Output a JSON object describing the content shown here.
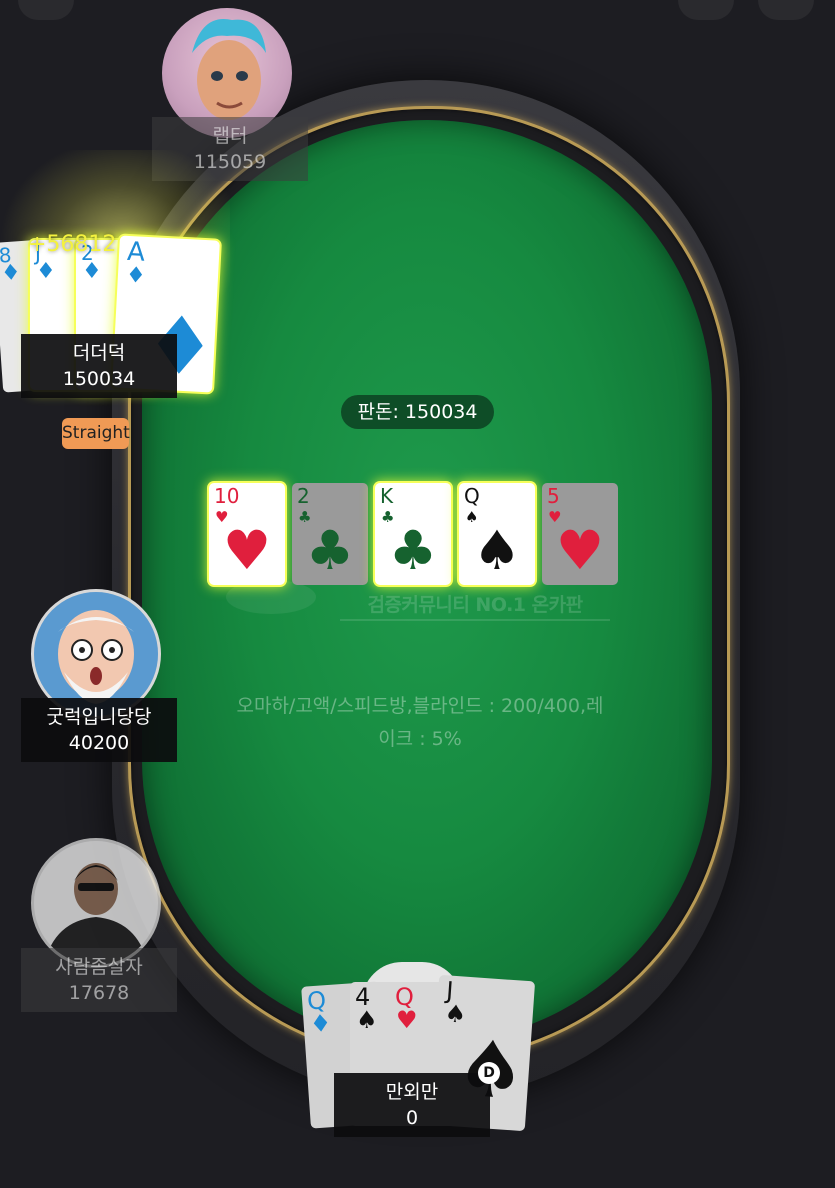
{
  "table": {
    "pot_label": "판돈: 150034",
    "watermark": "검증커뮤니티 NO.1 온카판",
    "info_line1": "오마하/고액/스피드방,블라인드 : 200/400,레",
    "info_line2": "이크 : 5%"
  },
  "board": [
    {
      "rank": "10",
      "suit": "♥",
      "color": "red",
      "highlight": true,
      "dimmed": false
    },
    {
      "rank": "2",
      "suit": "♣",
      "color": "green",
      "highlight": false,
      "dimmed": true
    },
    {
      "rank": "K",
      "suit": "♣",
      "color": "green",
      "highlight": true,
      "dimmed": false
    },
    {
      "rank": "Q",
      "suit": "♠",
      "color": "black",
      "highlight": true,
      "dimmed": false
    },
    {
      "rank": "5",
      "suit": "♥",
      "color": "red",
      "highlight": false,
      "dimmed": true
    }
  ],
  "players": {
    "top": {
      "name": "랩터",
      "chips": "115059"
    },
    "winner": {
      "name": "더더덕",
      "chips": "150034",
      "win_amount": "+56812",
      "hand": "Straight",
      "cards": [
        {
          "rank": "8",
          "suit": "♦"
        },
        {
          "rank": "J",
          "suit": "♦"
        },
        {
          "rank": "2",
          "suit": "♦"
        },
        {
          "rank": "A",
          "suit": "♦"
        }
      ]
    },
    "middle": {
      "name": "굿럭입니당당",
      "chips": "40200"
    },
    "lower": {
      "name": "사람좀살자",
      "chips": "17678"
    },
    "hero": {
      "name": "만외만",
      "chips": "0",
      "dealer": "D",
      "cards": [
        {
          "rank": "Q",
          "suit": "♦",
          "color": "blue"
        },
        {
          "rank": "4",
          "suit": "♠",
          "color": "black"
        },
        {
          "rank": "Q",
          "suit": "♥",
          "color": "red"
        },
        {
          "rank": "J",
          "suit": "♠",
          "color": "black"
        }
      ]
    }
  },
  "colors": {
    "felt": "#168a40",
    "rail_gold": "#b89a55",
    "win_text": "#f4f23e",
    "badge": "#f09a55"
  }
}
